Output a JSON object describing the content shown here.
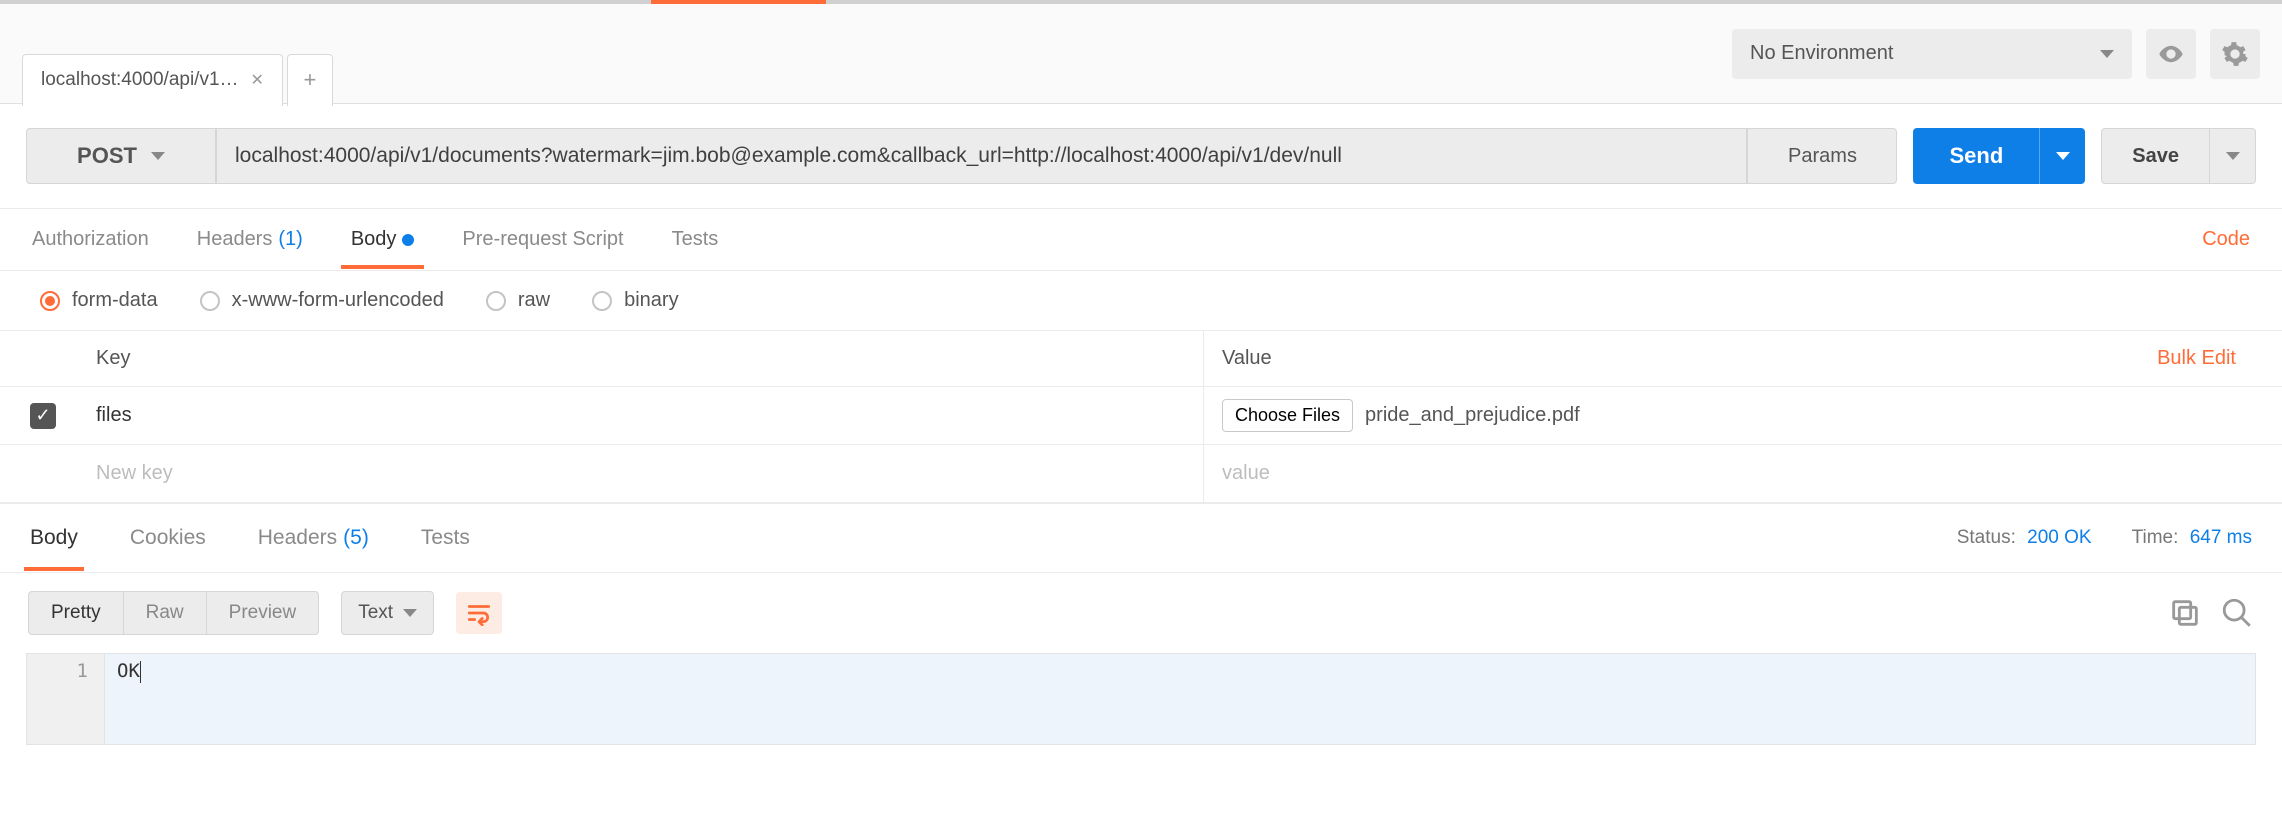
{
  "tab": {
    "label": "localhost:4000/api/v1…"
  },
  "topbar": {
    "env_label": "No Environment"
  },
  "request": {
    "method": "POST",
    "url": "localhost:4000/api/v1/documents?watermark=jim.bob@example.com&callback_url=http://localhost:4000/api/v1/dev/null",
    "params_label": "Params",
    "send_label": "Send",
    "save_label": "Save"
  },
  "req_tabs": {
    "authorization": "Authorization",
    "headers": "Headers",
    "headers_count": "(1)",
    "body": "Body",
    "prerequest": "Pre-request Script",
    "tests": "Tests",
    "code": "Code"
  },
  "body_types": {
    "form_data": "form-data",
    "urlencoded": "x-www-form-urlencoded",
    "raw": "raw",
    "binary": "binary"
  },
  "kv": {
    "key_header": "Key",
    "value_header": "Value",
    "bulk_edit": "Bulk Edit",
    "row": {
      "key": "files",
      "choose_label": "Choose Files",
      "file_name": "pride_and_prejudice.pdf"
    },
    "placeholder": {
      "key": "New key",
      "value": "value"
    }
  },
  "response": {
    "tabs": {
      "body": "Body",
      "cookies": "Cookies",
      "headers": "Headers",
      "headers_count": "(5)",
      "tests": "Tests"
    },
    "status_label": "Status:",
    "status_value": "200 OK",
    "time_label": "Time:",
    "time_value": "647 ms",
    "view": {
      "pretty": "Pretty",
      "raw": "Raw",
      "preview": "Preview",
      "format": "Text"
    },
    "line_number": "1",
    "body_text": "OK"
  }
}
